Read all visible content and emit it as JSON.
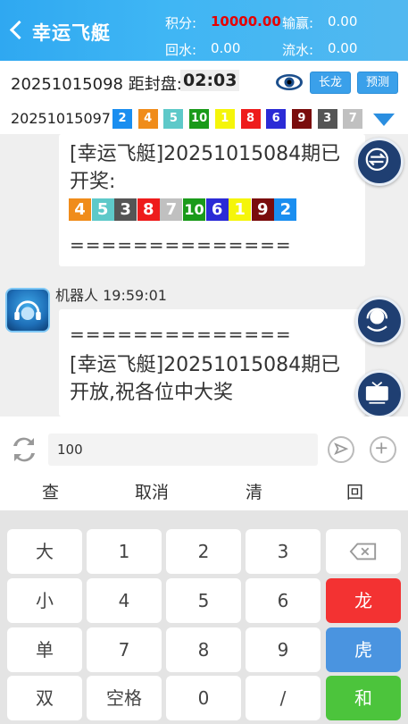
{
  "header": {
    "title": "幸运飞艇",
    "points_label": "积分:",
    "points_value": "10000.00",
    "winloss_label": "输赢:",
    "winloss_value": "0.00",
    "rebate_label": "回水:",
    "rebate_value": "0.00",
    "turnover_label": "流水:",
    "turnover_value": "0.00"
  },
  "infobar": {
    "period": "20251015098",
    "close_label": "距封盘:",
    "countdown": "02:03",
    "btn_long": "长龙",
    "btn_predict": "预测"
  },
  "prev_result": {
    "period": "20251015097",
    "balls": [
      "2",
      "4",
      "5",
      "10",
      "1",
      "8",
      "6",
      "9",
      "3",
      "7"
    ]
  },
  "chat": {
    "msg1_line1": "[幸运飞艇]20251015084期已",
    "msg1_line2": "开奖:",
    "msg1_balls": [
      "4",
      "5",
      "3",
      "8",
      "7",
      "10",
      "6",
      "1",
      "9",
      "2"
    ],
    "separator": "==============",
    "sender": "机器人 19:59:01",
    "msg2_sep": "==============",
    "msg2_line1": "[幸运飞艇]20251015084期已",
    "msg2_line2": "开放,祝各位中大奖"
  },
  "input": {
    "value": "100"
  },
  "quick_actions": {
    "check": "查",
    "cancel": "取消",
    "clear": "清",
    "back": "回"
  },
  "keypad": {
    "big": "大",
    "small": "小",
    "odd": "单",
    "even": "双",
    "k1": "1",
    "k2": "2",
    "k3": "3",
    "k4": "4",
    "k5": "5",
    "k6": "6",
    "k7": "7",
    "k8": "8",
    "k9": "9",
    "k0": "0",
    "space": "空格",
    "slash": "/",
    "dragon": "龙",
    "tiger": "虎",
    "tie": "和"
  },
  "colors": {
    "1": "#f5f50a",
    "2": "#1a8ef0",
    "3": "#555555",
    "4": "#f08c1a",
    "5": "#5ec9c9",
    "6": "#2b2bd6",
    "7": "#c0c0c0",
    "8": "#ee1c1c",
    "9": "#7a0d0d",
    "10": "#1a9a1a"
  }
}
